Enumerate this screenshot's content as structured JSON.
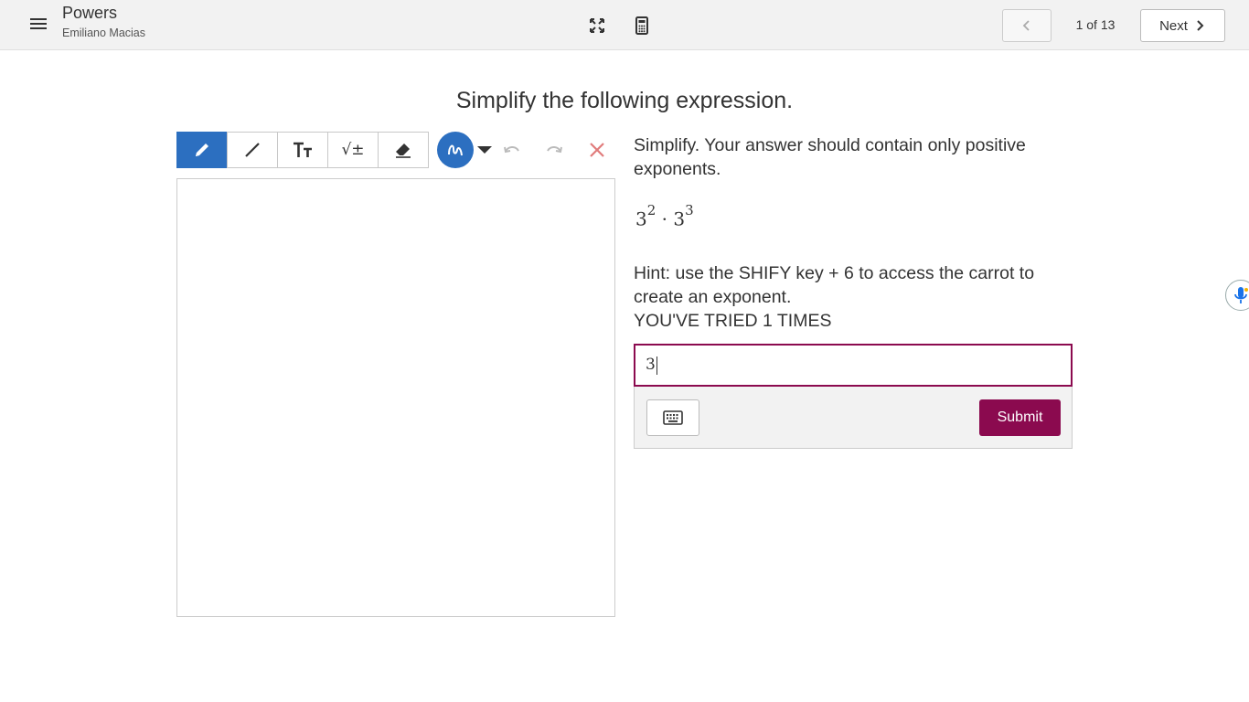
{
  "header": {
    "assignment_title": "Powers",
    "student_name": "Emiliano Macias",
    "page_indicator": "1 of 13",
    "next_label": "Next",
    "icons": [
      "menu-icon",
      "fullscreen-icon",
      "calculator-icon",
      "chevron-left-icon",
      "chevron-right-icon"
    ]
  },
  "main": {
    "heading": "Simplify the following expression.",
    "prompt": "Simplify. Your answer should contain only positive exponents.",
    "expression": {
      "base1": "3",
      "exp1": "2",
      "operator": "·",
      "base2": "3",
      "exp2": "3"
    },
    "hint": "Hint: use the SHIFY key + 6 to access the carrot to create an exponent.",
    "tries": "YOU'VE TRIED 1 TIMES",
    "answer_value": "3",
    "submit_label": "Submit"
  },
  "toolbar": {
    "tools": [
      "pencil-icon",
      "line-icon",
      "text-icon",
      "math-icon",
      "eraser-icon"
    ],
    "active_tool": "pencil",
    "math_tool_label": "√±",
    "accent_color": "#2c6fc0"
  },
  "colors": {
    "brand": "#8b0a4f",
    "accent": "#2c6fc0",
    "clear": "#e07b7b"
  }
}
